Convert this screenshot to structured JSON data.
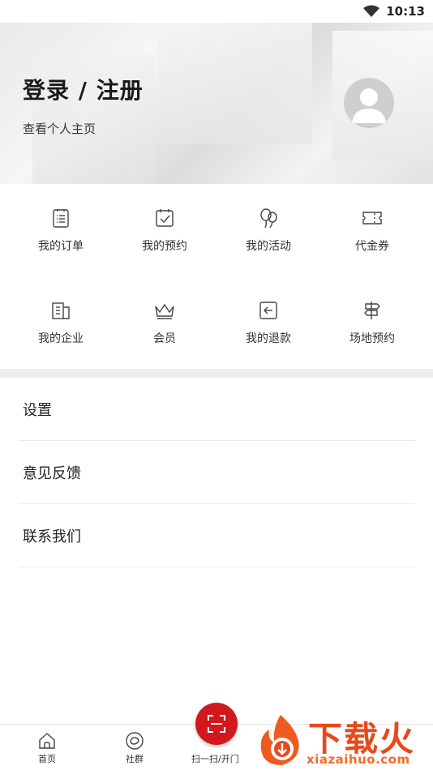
{
  "status_bar": {
    "time": "10:13"
  },
  "header": {
    "title": "登录 / 注册",
    "subtitle": "查看个人主页"
  },
  "grid": {
    "row1": [
      {
        "label": "我的订单",
        "icon": "order-list-icon"
      },
      {
        "label": "我的预约",
        "icon": "calendar-check-icon"
      },
      {
        "label": "我的活动",
        "icon": "balloons-icon"
      },
      {
        "label": "代金券",
        "icon": "ticket-icon"
      }
    ],
    "row2": [
      {
        "label": "我的企业",
        "icon": "building-icon"
      },
      {
        "label": "会员",
        "icon": "crown-icon"
      },
      {
        "label": "我的退款",
        "icon": "refund-icon"
      },
      {
        "label": "场地预约",
        "icon": "signpost-icon"
      }
    ]
  },
  "menu": [
    {
      "label": "设置"
    },
    {
      "label": "意见反馈"
    },
    {
      "label": "联系我们"
    }
  ],
  "bottom_nav": {
    "home": "首页",
    "community": "社群",
    "scan": "扫一扫/开门"
  },
  "watermark": {
    "text": "下载火",
    "sub": "xiazaihuo.com"
  },
  "colors": {
    "accent": "#d0191f",
    "watermark": "#e8481c"
  }
}
